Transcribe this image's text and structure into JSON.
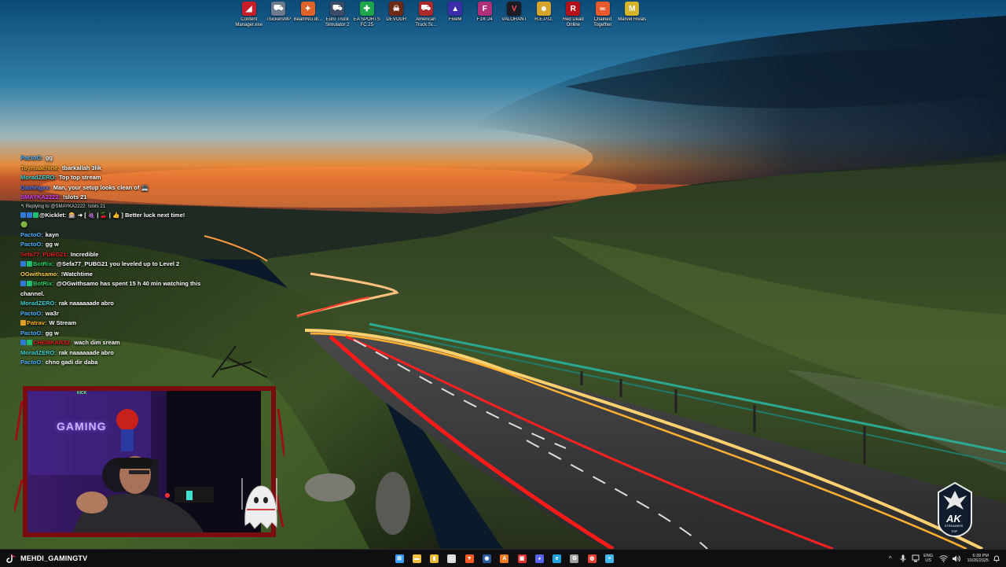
{
  "desktop": {
    "icons": [
      {
        "label": "Content Manager.exe",
        "icon": "content-manager-icon",
        "color": "#c81e2a",
        "glyph": "◢"
      },
      {
        "label": "TruckersMP",
        "icon": "truckersmp-icon",
        "color": "#6b7a8c",
        "glyph": "⛟"
      },
      {
        "label": "BeamNG.dr...",
        "icon": "beamng-icon",
        "color": "#e0642a",
        "glyph": "✦"
      },
      {
        "label": "Euro Truck Simulator 2",
        "icon": "euro-truck-icon",
        "color": "#3d4b6a",
        "glyph": "⛟"
      },
      {
        "label": "EA SPORTS FC 25",
        "icon": "ea-fc-icon",
        "color": "#1ea64a",
        "glyph": "✚"
      },
      {
        "label": "DEVOUR",
        "icon": "devour-icon",
        "color": "#6a2a14",
        "glyph": "☠"
      },
      {
        "label": "American Truck Si...",
        "icon": "american-truck-icon",
        "color": "#aa2a2a",
        "glyph": "⛟"
      },
      {
        "label": "FiveM",
        "icon": "fivem-icon",
        "color": "#3a2fa8",
        "glyph": "▲"
      },
      {
        "label": "F1® 24",
        "icon": "f1-icon",
        "color": "#b02f7a",
        "glyph": "F"
      },
      {
        "label": "VALORANT",
        "icon": "valorant-icon",
        "color": "#1c1c24",
        "glyph": "V"
      },
      {
        "label": "R.E.P.O.",
        "icon": "repo-icon",
        "color": "#d4a52a",
        "glyph": "☻"
      },
      {
        "label": "Red Dead Online",
        "icon": "red-dead-icon",
        "color": "#b3121b",
        "glyph": "R"
      },
      {
        "label": "Chained Together",
        "icon": "chained-together-icon",
        "color": "#e85a2e",
        "glyph": "∞"
      },
      {
        "label": "Marvel Rivals",
        "icon": "marvel-rivals-icon",
        "color": "#d6b42a",
        "glyph": "M"
      }
    ]
  },
  "chat": {
    "messages": [
      {
        "user": "PactoO:",
        "text": "gg",
        "color": "#4fb0ff",
        "badges": []
      },
      {
        "user": "Toymaachine:",
        "text": "tbarkallah 3lik",
        "color": "#ffb020",
        "badges": []
      },
      {
        "user": "MoradZERO:",
        "text": "Top top stream",
        "color": "#40d0d0",
        "badges": []
      },
      {
        "user": "Gamingxx:",
        "text": "Man, your setup looks clean of 💻",
        "color": "#4a7cff",
        "badges": []
      },
      {
        "user": "SMAYKA2222:",
        "text": "!slots 21",
        "color": "#e040ff",
        "badges": []
      },
      {
        "user": "",
        "text": "↰ Replying to @SMAYKA2222: !slots 21",
        "color": "#dddddd",
        "badges": [],
        "reply": true
      },
      {
        "user": "@Kicklet:",
        "text": "🎰 ➜ [ 🍇 | 🍒 | 👍 ] Better luck next time!",
        "color": "#ffffff",
        "badges": [
          "#2f7bd8",
          "#2f7bd8",
          "#20c070"
        ]
      },
      {
        "user": "",
        "text": "🟢",
        "color": "#ffffff",
        "badges": []
      },
      {
        "user": "PactoO:",
        "text": "kayn",
        "color": "#4fb0ff",
        "badges": []
      },
      {
        "user": "PactoO:",
        "text": "gg w",
        "color": "#4fb0ff",
        "badges": []
      },
      {
        "user": "Sefa77_PUBG21:",
        "text": "Incredible",
        "color": "#e02020",
        "badges": []
      },
      {
        "user": "BotRix:",
        "text": "@Sefa77_PUBG21 you leveled up to Level 2",
        "color": "#20d060",
        "badges": [
          "#2f7bd8",
          "#20c070"
        ]
      },
      {
        "user": "OGwithsamo:",
        "text": "!Watchtime",
        "color": "#ffd040",
        "badges": []
      },
      {
        "user": "BotRix:",
        "text": "@OGwithsamo has spent 15 h 40 min watching this channel.",
        "color": "#20d060",
        "badges": [
          "#2f7bd8",
          "#20c070"
        ],
        "wrap": true
      },
      {
        "user": "MoradZERO:",
        "text": "rak naaaaaade abro",
        "color": "#40d0d0",
        "badges": []
      },
      {
        "user": "PactoO:",
        "text": "wa3r",
        "color": "#4fb0ff",
        "badges": []
      },
      {
        "user": "Patrav:",
        "text": "W Stream",
        "color": "#ffb020",
        "badges": [
          "#e0a020"
        ]
      },
      {
        "user": "PactoO:",
        "text": "gg w",
        "color": "#4fb0ff",
        "badges": []
      },
      {
        "user": "CHEMKAR32:",
        "text": "wach dim sream",
        "color": "#e02020",
        "badges": [
          "#2f7bd8",
          "#20c070"
        ]
      },
      {
        "user": "MoradZERO:",
        "text": "rak naaaaaade abro",
        "color": "#40d0d0",
        "badges": []
      },
      {
        "user": "PactoO:",
        "text": "chno gadi dir daba",
        "color": "#4fb0ff",
        "badges": []
      }
    ]
  },
  "webcam": {
    "neon_sign": "GAMING",
    "top_label": "KICK"
  },
  "logo": {
    "text": "AK",
    "subtext": "STREAMERS",
    "tag": "TOP"
  },
  "taskbar": {
    "streamer_name": "MEHDI_GAMINGTV",
    "apps": [
      {
        "icon": "windows-start-icon",
        "color": "#3aa0ff",
        "glyph": "⊞"
      },
      {
        "icon": "file-explorer-icon",
        "color": "#f0c040",
        "glyph": "▬"
      },
      {
        "icon": "folder-icon",
        "color": "#e8b830",
        "glyph": "▮"
      },
      {
        "icon": "screen-capture-icon",
        "color": "#dddddd",
        "glyph": "▭"
      },
      {
        "icon": "brave-browser-icon",
        "color": "#ff5a20",
        "glyph": "▼"
      },
      {
        "icon": "steam-icon",
        "color": "#2a5a9a",
        "glyph": "◉"
      },
      {
        "icon": "app-orange-icon",
        "color": "#f07a20",
        "glyph": "A"
      },
      {
        "icon": "roblox-icon",
        "color": "#e03030",
        "glyph": "▣"
      },
      {
        "icon": "discord-icon",
        "color": "#5865f2",
        "glyph": "◕"
      },
      {
        "icon": "edge-icon",
        "color": "#1fa0e0",
        "glyph": "e"
      },
      {
        "icon": "settings-icon",
        "color": "#a0a0a0",
        "glyph": "⚙"
      },
      {
        "icon": "chrome-icon",
        "color": "#e84030",
        "glyph": "◍"
      },
      {
        "icon": "notepad-icon",
        "color": "#40b8f0",
        "glyph": "≡"
      }
    ],
    "tray": {
      "chevron": "^",
      "lang_top": "ENG",
      "lang_bottom": "US",
      "time": "6:39 PM",
      "date": "10/26/2025"
    }
  },
  "colors": {
    "accent_orange": "#ff8a2a",
    "taskbar": "#0f0f12",
    "light_trail_red": "#ff2a2a",
    "light_trail_gold": "#ffc060"
  }
}
